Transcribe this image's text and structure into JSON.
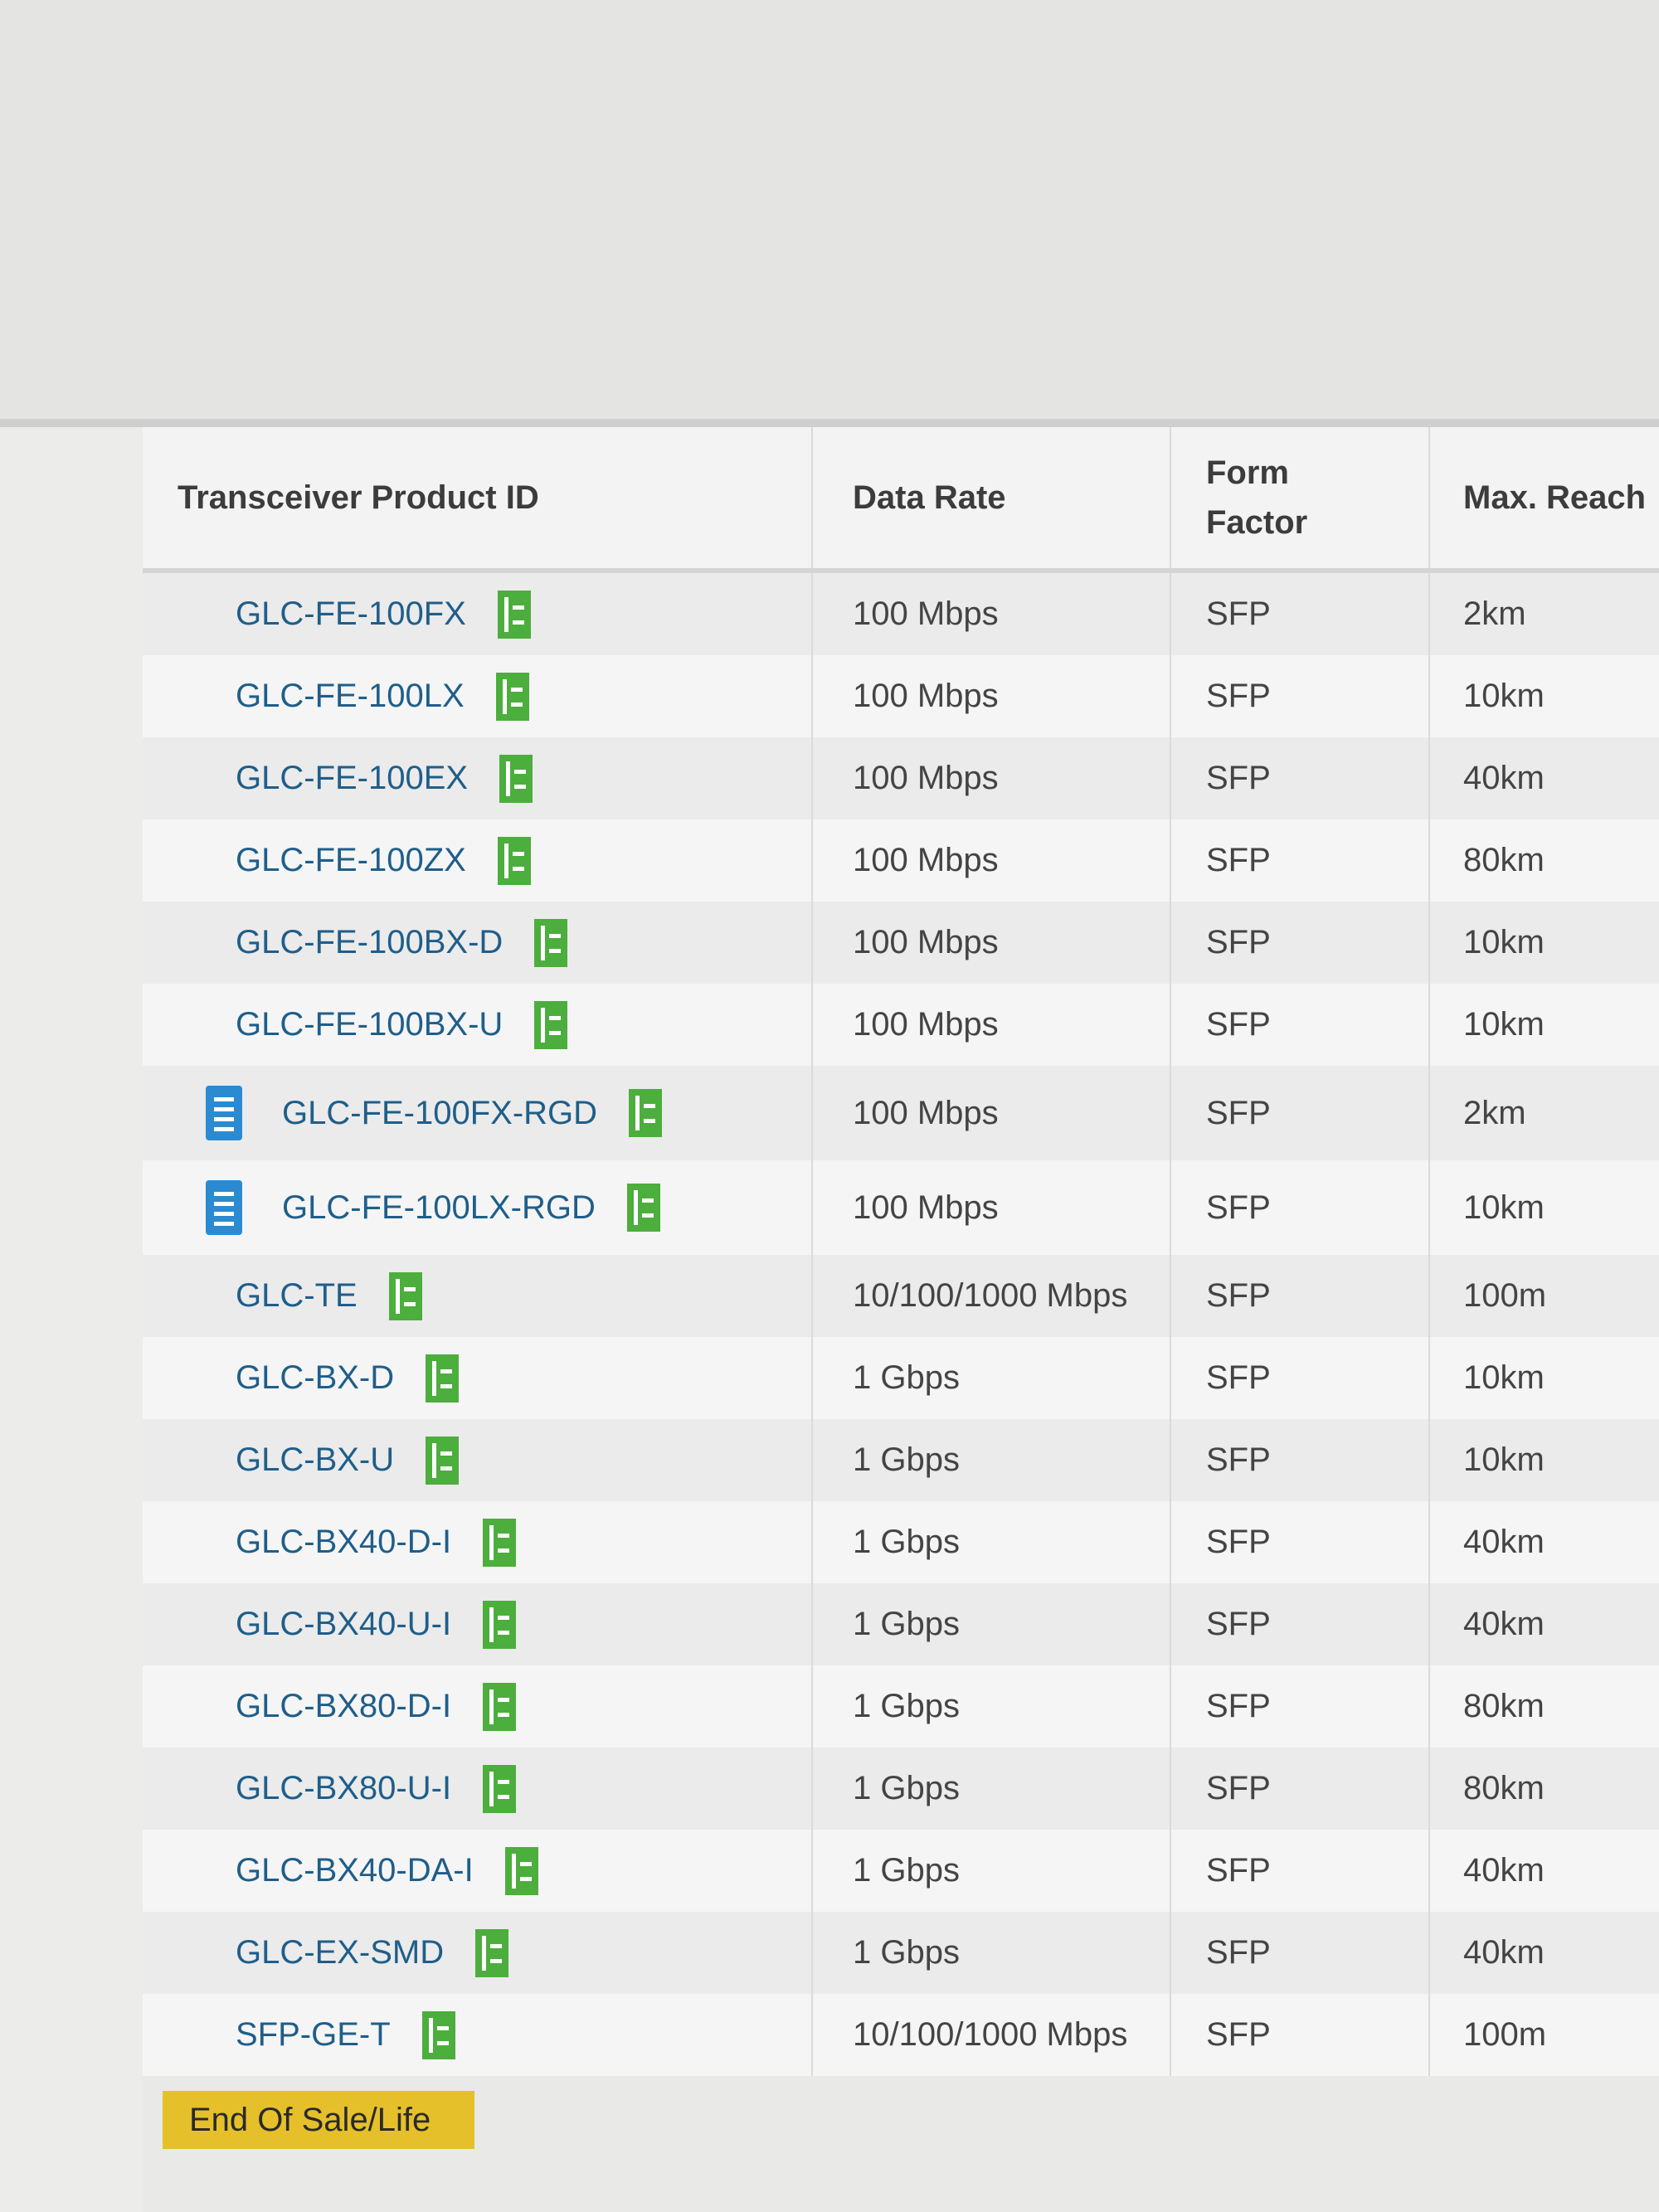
{
  "table": {
    "headers": {
      "product_id": "Transceiver Product ID",
      "data_rate": "Data Rate",
      "form_factor": "Form Factor",
      "max_reach": "Max. Reach"
    },
    "rows": [
      {
        "product_id": "GLC-FE-100FX",
        "data_rate": "100 Mbps",
        "form_factor": "SFP",
        "max_reach": "2km",
        "doc_icon": false
      },
      {
        "product_id": "GLC-FE-100LX",
        "data_rate": "100 Mbps",
        "form_factor": "SFP",
        "max_reach": "10km",
        "doc_icon": false
      },
      {
        "product_id": "GLC-FE-100EX",
        "data_rate": "100 Mbps",
        "form_factor": "SFP",
        "max_reach": "40km",
        "doc_icon": false
      },
      {
        "product_id": "GLC-FE-100ZX",
        "data_rate": "100 Mbps",
        "form_factor": "SFP",
        "max_reach": "80km",
        "doc_icon": false
      },
      {
        "product_id": "GLC-FE-100BX-D",
        "data_rate": "100 Mbps",
        "form_factor": "SFP",
        "max_reach": "10km",
        "doc_icon": false
      },
      {
        "product_id": "GLC-FE-100BX-U",
        "data_rate": "100 Mbps",
        "form_factor": "SFP",
        "max_reach": "10km",
        "doc_icon": false
      },
      {
        "product_id": "GLC-FE-100FX-RGD",
        "data_rate": "100 Mbps",
        "form_factor": "SFP",
        "max_reach": "2km",
        "doc_icon": true
      },
      {
        "product_id": "GLC-FE-100LX-RGD",
        "data_rate": "100 Mbps",
        "form_factor": "SFP",
        "max_reach": "10km",
        "doc_icon": true
      },
      {
        "product_id": "GLC-TE",
        "data_rate": "10/100/1000 Mbps",
        "form_factor": "SFP",
        "max_reach": "100m",
        "doc_icon": false
      },
      {
        "product_id": "GLC-BX-D",
        "data_rate": "1 Gbps",
        "form_factor": "SFP",
        "max_reach": "10km",
        "doc_icon": false
      },
      {
        "product_id": "GLC-BX-U",
        "data_rate": "1 Gbps",
        "form_factor": "SFP",
        "max_reach": "10km",
        "doc_icon": false
      },
      {
        "product_id": "GLC-BX40-D-I",
        "data_rate": "1 Gbps",
        "form_factor": "SFP",
        "max_reach": "40km",
        "doc_icon": false
      },
      {
        "product_id": "GLC-BX40-U-I",
        "data_rate": "1 Gbps",
        "form_factor": "SFP",
        "max_reach": "40km",
        "doc_icon": false
      },
      {
        "product_id": "GLC-BX80-D-I",
        "data_rate": "1 Gbps",
        "form_factor": "SFP",
        "max_reach": "80km",
        "doc_icon": false
      },
      {
        "product_id": "GLC-BX80-U-I",
        "data_rate": "1 Gbps",
        "form_factor": "SFP",
        "max_reach": "80km",
        "doc_icon": false
      },
      {
        "product_id": "GLC-BX40-DA-I",
        "data_rate": "1 Gbps",
        "form_factor": "SFP",
        "max_reach": "40km",
        "doc_icon": false
      },
      {
        "product_id": "GLC-EX-SMD",
        "data_rate": "1 Gbps",
        "form_factor": "SFP",
        "max_reach": "40km",
        "doc_icon": false
      },
      {
        "product_id": "SFP-GE-T",
        "data_rate": "10/100/1000 Mbps",
        "form_factor": "SFP",
        "max_reach": "100m",
        "doc_icon": false
      }
    ]
  },
  "legend": {
    "end_of_sale_label": "End Of Sale/Life"
  },
  "colors": {
    "link": "#1f5e8a",
    "sfp_icon": "#4cae3c",
    "doc_icon": "#2b8ad0",
    "end_of_sale": "#e6c02a"
  },
  "icons": {
    "sfp": "sfp-module-icon",
    "doc": "document-icon"
  }
}
